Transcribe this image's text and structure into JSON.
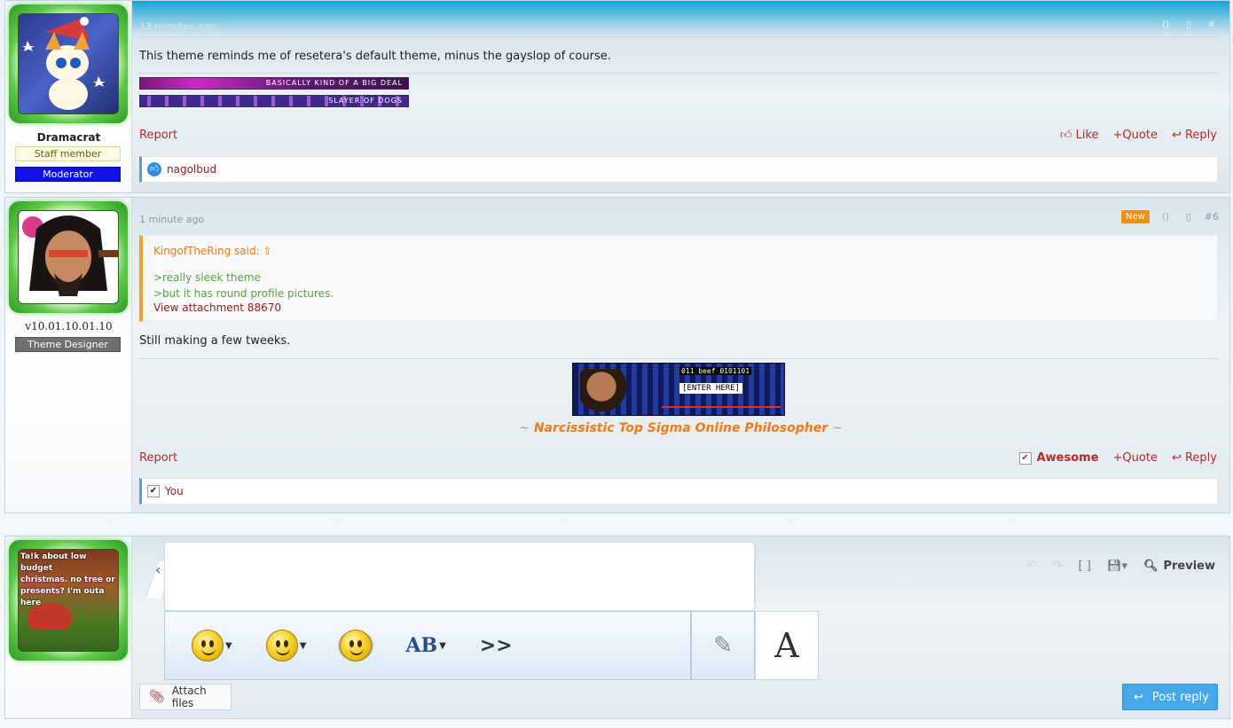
{
  "posts": [
    {
      "username": "Dramacrat",
      "banners": [
        "Staff member",
        "Moderator"
      ],
      "time": "13 minutes ago",
      "text": "This theme reminds me of resetera's default theme, minus the gayslop of course.",
      "signature_bars": [
        "BASICALLY KIND OF A BIG DEAL",
        "SLAYER OF DOGS"
      ],
      "actions": {
        "report": "Report",
        "like": "Like",
        "quote": "Quote",
        "reply": "Reply"
      },
      "reactions": "nagolbud"
    },
    {
      "username": "v10.01.10.01.10",
      "banners": [
        "Theme Designer"
      ],
      "time": "1 minute ago",
      "new_badge": "New",
      "post_number": "#6",
      "quote": {
        "author": "KingofTheRing said:",
        "lines": [
          ">really sleek theme",
          ">but it has round profile pictures."
        ],
        "attachment": "View attachment 88670"
      },
      "text": "Still making a few tweeks.",
      "signature_image": {
        "code": "011 beef 0101101",
        "label": "[ENTER HERE]"
      },
      "signature_text": "Narcissistic Top Sigma Online Philosopher",
      "tilde": "~",
      "actions": {
        "report": "Report",
        "reaction": "Awesome",
        "quote": "Quote",
        "reply": "Reply"
      },
      "reactions": "You"
    }
  ],
  "reply_box": {
    "avatar_caption": [
      "Ta!k about low budget",
      "christmas",
      "no",
      "tree",
      "or",
      "presents",
      "? I'm outa here"
    ],
    "preview": "Preview",
    "attach": "Attach files",
    "post_reply": "Post reply",
    "font_tool": "A",
    "more_tool": ">>",
    "ab_tool": "AB"
  }
}
